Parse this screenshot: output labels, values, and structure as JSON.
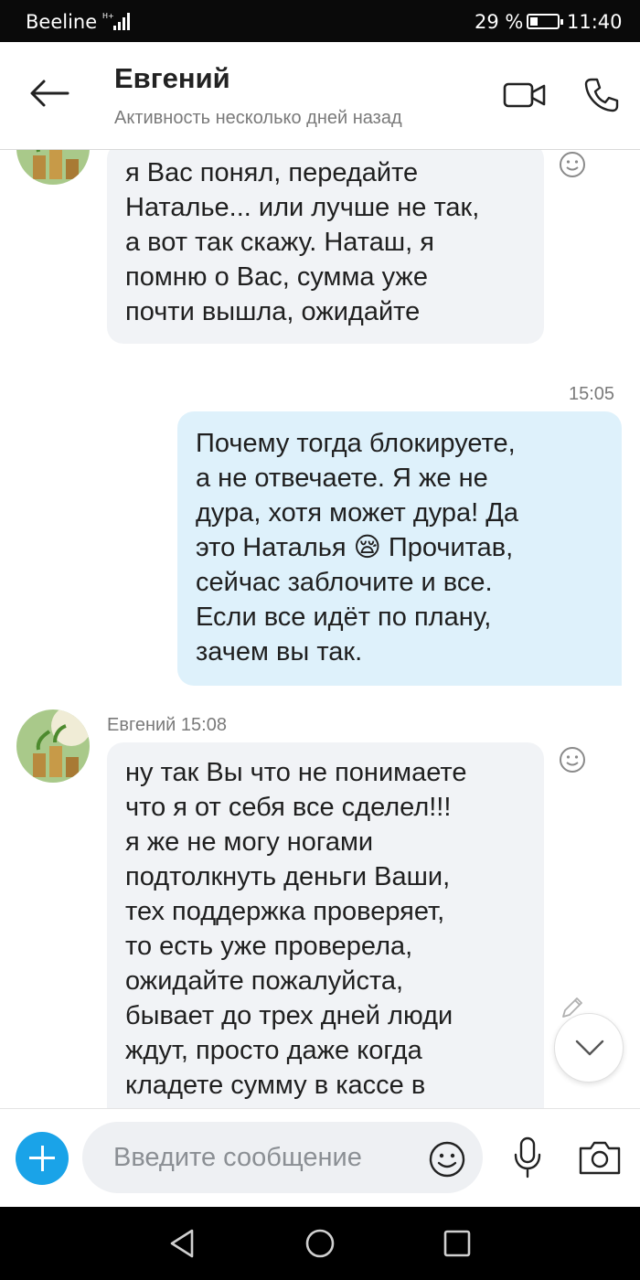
{
  "status_bar": {
    "carrier": "Beeline",
    "battery_percent": "29 %",
    "battery_level": 0.29,
    "time": "11:40"
  },
  "header": {
    "contact_name": "Евгений",
    "presence": "Активность несколько дней назад",
    "icons": [
      "back-arrow-icon",
      "video-call-icon",
      "phone-icon"
    ]
  },
  "messages": [
    {
      "direction": "incoming",
      "text": "я Вас понял, передайте\nНаталье... или лучше не так,\nа вот так скажу. Наташ, я\nпомню о Вас, сумма уже\nпочти вышла, ожидайте"
    },
    {
      "direction": "outgoing",
      "time": "15:05",
      "text_before_emoji": "Почему тогда блокируете,\nа не отвечаете. Я же не\nдура, хотя может дура!  Да\nэто Наталья ",
      "emoji": "😪",
      "text_after_emoji": " Прочитав,\nсейчас заблочите и все.\nЕсли все идёт по плану,\nзачем вы так."
    },
    {
      "direction": "incoming",
      "sender_meta": "Евгений 15:08",
      "text": "ну так Вы что не понимаете\nчто я от себя все сделел!!!\nя же не могу ногами\nподтолкнуть деньги Ваши,\nтех поддержка проверяет,\nто есть уже проверела,\nожидайте пожалуйста,\nбывает до трех дней люди\nждут, просто даже когда\nкладете сумму в кассе в"
    }
  ],
  "composer": {
    "placeholder": "Введите сообщение",
    "icons": [
      "plus-icon",
      "emoji-icon",
      "microphone-icon",
      "camera-icon"
    ]
  },
  "colors": {
    "accent": "#1aa3e8",
    "incoming_bubble": "#f1f3f6",
    "outgoing_bubble": "#def1fb",
    "meta_text": "#7a7a7a"
  }
}
